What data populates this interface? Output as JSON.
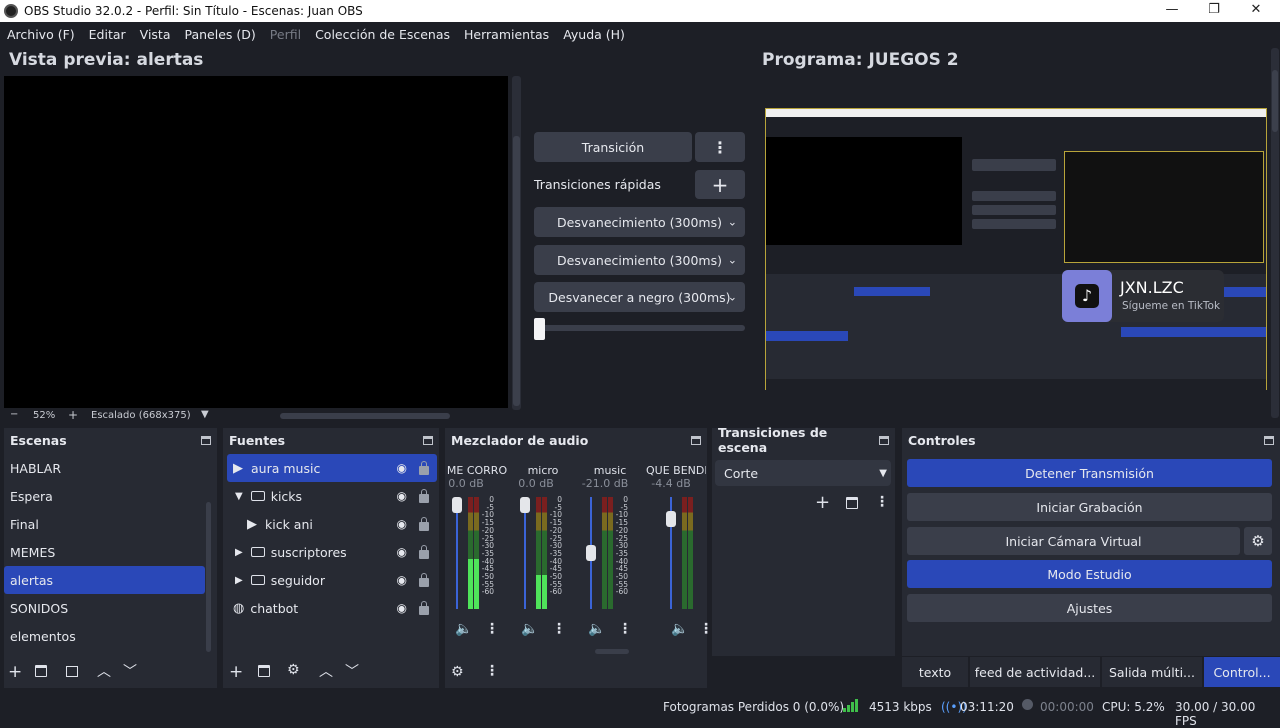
{
  "window": {
    "title": "OBS Studio 32.0.2 - Perfil: Sin Título - Escenas: Juan OBS"
  },
  "menu": [
    "Archivo (F)",
    "Editar",
    "Vista",
    "Paneles (D)",
    "Perfil",
    "Colección de Escenas",
    "Herramientas",
    "Ayuda (H)"
  ],
  "preview": {
    "title": "Vista previa: alertas",
    "zoom": "52%",
    "scale_label": "Escalado (668x375)"
  },
  "program": {
    "title": "Programa: JUEGOS 2"
  },
  "overlay": {
    "name": "JXN.LZC",
    "sub": "Sígueme en TikTok"
  },
  "transitions_panel": {
    "transition_btn": "Transición",
    "quick_label": "Transiciones rápidas",
    "quick": [
      "Desvanecimiento (300ms)",
      "Desvanecimiento (300ms)",
      "Desvanecer a negro (300ms)"
    ]
  },
  "scenes": {
    "title": "Escenas",
    "items": [
      "HABLAR",
      "Espera",
      "Final",
      "MEMES",
      "alertas",
      "SONIDOS",
      "elementos"
    ],
    "selected": 4
  },
  "sources": {
    "title": "Fuentes",
    "items": [
      "aura music",
      "kicks",
      "kick ani",
      "suscriptores",
      "seguidor",
      "chatbot"
    ]
  },
  "mixer": {
    "title": "Mezclador de audio",
    "channels": [
      {
        "name": "ME CORRO",
        "db": "0.0 dB",
        "fader": 1.0,
        "level": 0.45
      },
      {
        "name": "micro",
        "db": "0.0 dB",
        "fader": 1.0,
        "level": 0.3
      },
      {
        "name": "music",
        "db": "-21.0 dB",
        "fader": 0.5,
        "level": 0.0
      },
      {
        "name": "QUE BENDI",
        "db": "-4.4 dB",
        "fader": 0.85,
        "level": 0.0
      }
    ],
    "scale": [
      "0",
      "-5",
      "-10",
      "-15",
      "-20",
      "-25",
      "-30",
      "-35",
      "-40",
      "-45",
      "-50",
      "-55",
      "-60"
    ]
  },
  "scene_transitions": {
    "title": "Transiciones de escena",
    "selected": "Corte"
  },
  "controls": {
    "title": "Controles",
    "buttons": [
      "Detener Transmisión",
      "Iniciar Grabación",
      "Iniciar Cámara Virtual",
      "Modo Estudio",
      "Ajustes"
    ]
  },
  "bottom_tabs": [
    "texto",
    "feed de actividad...",
    "Salida múlti...",
    "Control..."
  ],
  "status": {
    "dropped": "Fotogramas Perdidos 0 (0.0%)",
    "bitrate": "4513 kbps",
    "stream_time": "03:11:20",
    "rec_time": "00:00:00",
    "cpu": "CPU: 5.2%",
    "fps": "30.00 / 30.00 FPS"
  },
  "colors": {
    "accent": "#2a48b8",
    "panel": "#272a33",
    "bg": "#1d1f26"
  }
}
